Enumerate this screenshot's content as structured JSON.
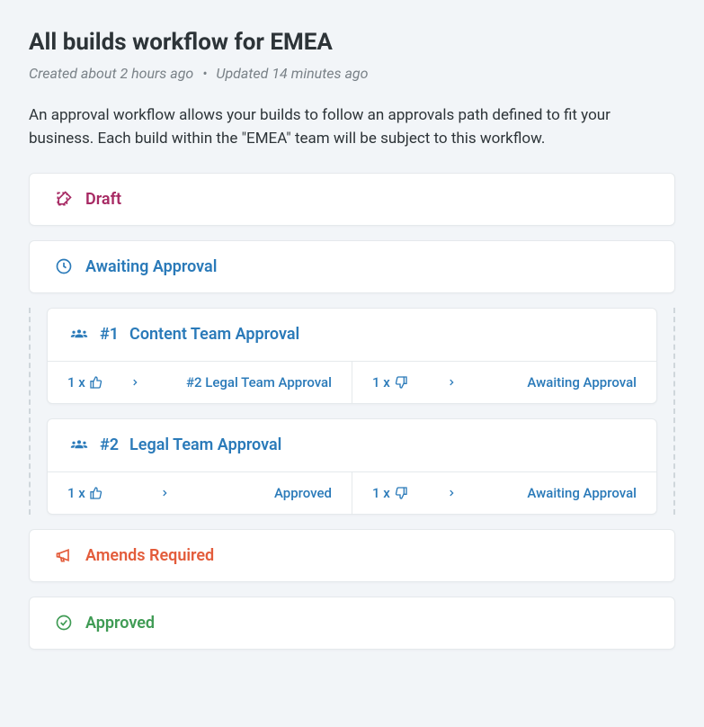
{
  "header": {
    "title": "All builds workflow for EMEA",
    "created": "Created about 2 hours ago",
    "updated": "Updated 14 minutes ago",
    "dot": "•"
  },
  "description": "An approval workflow allows your builds to follow an approvals path defined to fit your business. Each build within the \"EMEA\" team will be subject to this workflow.",
  "states": {
    "draft": "Draft",
    "awaiting": "Awaiting Approval",
    "amends": "Amends Required",
    "approved": "Approved"
  },
  "stages": [
    {
      "number": "#1",
      "name": "Content Team Approval",
      "approve": {
        "count": "1 x",
        "dest": "#2 Legal Team Approval"
      },
      "reject": {
        "count": "1 x",
        "dest": "Awaiting Approval"
      }
    },
    {
      "number": "#2",
      "name": "Legal Team Approval",
      "approve": {
        "count": "1 x",
        "dest": "Approved"
      },
      "reject": {
        "count": "1 x",
        "dest": "Awaiting Approval"
      }
    }
  ]
}
